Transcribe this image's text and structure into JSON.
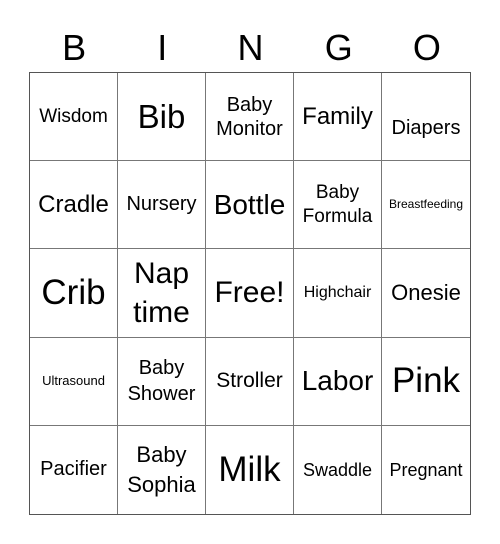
{
  "header": [
    "B",
    "I",
    "N",
    "G",
    "O"
  ],
  "cells": [
    "Wisdom",
    "Bib",
    "Baby\nMonitor",
    "Family",
    "Diapers",
    "Cradle",
    "Nursery",
    "Bottle",
    "Baby\nFormula",
    "Breastfeeding",
    "Crib",
    "Nap\ntime",
    "Free!",
    "Highchair",
    "Onesie",
    "Ultrasound",
    "Baby\nShower",
    "Stroller",
    "Labor",
    "Pink",
    "Pacifier",
    "Baby\nSophia",
    "Milk",
    "Swaddle",
    "Pregnant"
  ]
}
